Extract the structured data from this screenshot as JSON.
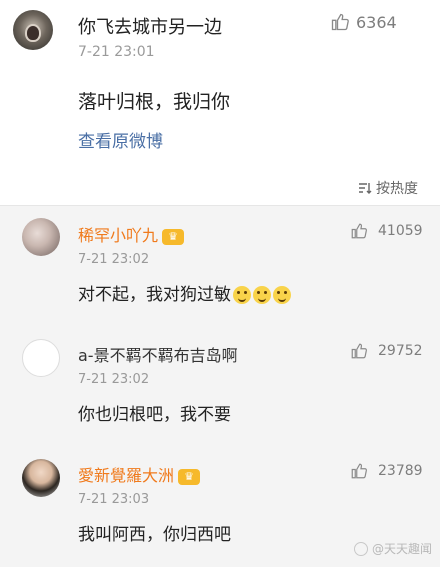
{
  "main_post": {
    "author": "你飞去城市另一边",
    "time": "7-21 23:01",
    "likes": "6364",
    "text": "落叶归根，我归你",
    "view_original": "查看原微博"
  },
  "sort_label": "按热度",
  "comments": [
    {
      "author": "稀罕小吖九",
      "vip": true,
      "time": "7-21 23:02",
      "text": "对不起，我对狗过敏",
      "emoji_count": 3,
      "likes": "41059",
      "name_color": "#f07a1c"
    },
    {
      "author": "a-景不羁不羁布吉岛啊",
      "vip": false,
      "time": "7-21 23:02",
      "text": "你也归根吧，我不要",
      "likes": "29752",
      "name_color": "#333333"
    },
    {
      "author": "愛新覺羅大洲",
      "vip": true,
      "time": "7-21 23:03",
      "text": "我叫阿西，你归西吧",
      "likes": "23789",
      "name_color": "#f07a1c"
    }
  ],
  "watermark": "@天天趣闻"
}
